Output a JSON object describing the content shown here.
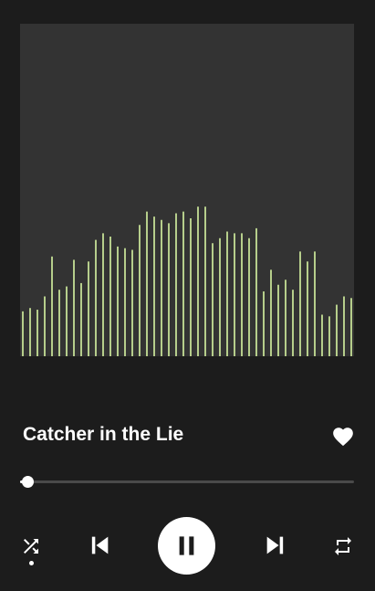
{
  "player": {
    "track_title": "Catcher in the Lie",
    "liked": true,
    "progress_fraction": 0.02,
    "shuffle_active": true
  },
  "visualizer": {
    "bar_color": "#d8f5a2",
    "background_color": "#333333",
    "levels": [
      0.135,
      0.145,
      0.14,
      0.18,
      0.3,
      0.2,
      0.21,
      0.29,
      0.22,
      0.285,
      0.35,
      0.37,
      0.36,
      0.33,
      0.325,
      0.32,
      0.395,
      0.435,
      0.42,
      0.41,
      0.4,
      0.43,
      0.435,
      0.415,
      0.45,
      0.45,
      0.34,
      0.355,
      0.375,
      0.37,
      0.37,
      0.355,
      0.385,
      0.195,
      0.26,
      0.215,
      0.23,
      0.2,
      0.315,
      0.285,
      0.315,
      0.125,
      0.12,
      0.155,
      0.18,
      0.175
    ]
  },
  "icons": {
    "heart": "heart-icon",
    "shuffle": "shuffle-icon",
    "previous": "skip-previous-icon",
    "pause": "pause-icon",
    "next": "skip-next-icon",
    "repeat": "repeat-icon"
  }
}
